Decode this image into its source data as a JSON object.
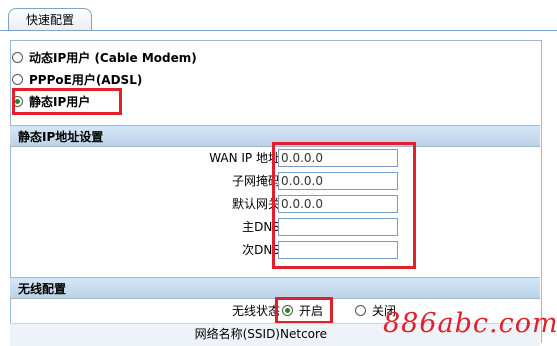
{
  "tab": {
    "label": "快速配置"
  },
  "wan_modes": [
    {
      "label": "动态IP用户 (Cable Modem)",
      "checked": false
    },
    {
      "label": "PPPoE用户(ADSL)",
      "checked": false
    },
    {
      "label": "静态IP用户",
      "checked": true
    }
  ],
  "static_ip": {
    "section_title": "静态IP地址设置",
    "fields": [
      {
        "label": "WAN IP 地址",
        "value": "0.0.0.0"
      },
      {
        "label": "子网掩码",
        "value": "0.0.0.0"
      },
      {
        "label": "默认网关",
        "value": "0.0.0.0"
      },
      {
        "label": "主DNS",
        "value": ""
      },
      {
        "label": "次DNS",
        "value": ""
      }
    ]
  },
  "wireless": {
    "section_title": "无线配置",
    "status_label": "无线状态",
    "on_label": "开启",
    "off_label": "关闭",
    "on_checked": true,
    "ssid_label": "网络名称(SSID)",
    "ssid_value": "Netcore"
  },
  "watermark": "886abc.com",
  "colors": {
    "highlight": "#e0202a",
    "section_bg": "#c8dbee",
    "radio_dot": "#1e8a1e"
  }
}
